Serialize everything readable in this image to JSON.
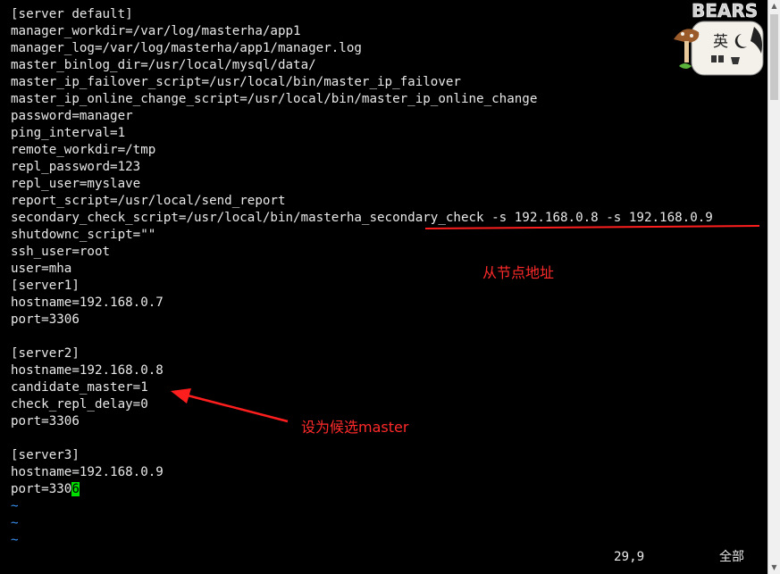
{
  "terminal": {
    "lines": [
      "[server default]",
      "manager_workdir=/var/log/masterha/app1",
      "manager_log=/var/log/masterha/app1/manager.log",
      "master_binlog_dir=/usr/local/mysql/data/",
      "master_ip_failover_script=/usr/local/bin/master_ip_failover",
      "master_ip_online_change_script=/usr/local/bin/master_ip_online_change",
      "password=manager",
      "ping_interval=1",
      "remote_workdir=/tmp",
      "repl_password=123",
      "repl_user=myslave",
      "report_script=/usr/local/send_report",
      "secondary_check_script=/usr/local/bin/masterha_secondary_check -s 192.168.0.8 -s 192.168.0.9",
      "shutdownc_script=\"\"",
      "ssh_user=root",
      "user=mha",
      "[server1]",
      "hostname=192.168.0.7",
      "port=3306",
      "",
      "[server2]",
      "hostname=192.168.0.8",
      "candidate_master=1",
      "check_repl_delay=0",
      "port=3306",
      "",
      "[server3]",
      "hostname=192.168.0.9"
    ],
    "cursor_line_before": "port=330",
    "cursor_char": "6",
    "tildes": [
      "~",
      "~",
      "~"
    ]
  },
  "status_bar": {
    "position": "29,9",
    "scroll_state": "全部"
  },
  "annotations": {
    "slave_addresses": "从节点地址",
    "candidate_master": "设为候选master"
  },
  "sticker": {
    "text": "BEARS",
    "glyph": "英"
  },
  "colors": {
    "background": "#000000",
    "text": "#e8e8e8",
    "tilde": "#3b8ef0",
    "cursor": "#00e000",
    "annotation": "#ff2a2a"
  }
}
